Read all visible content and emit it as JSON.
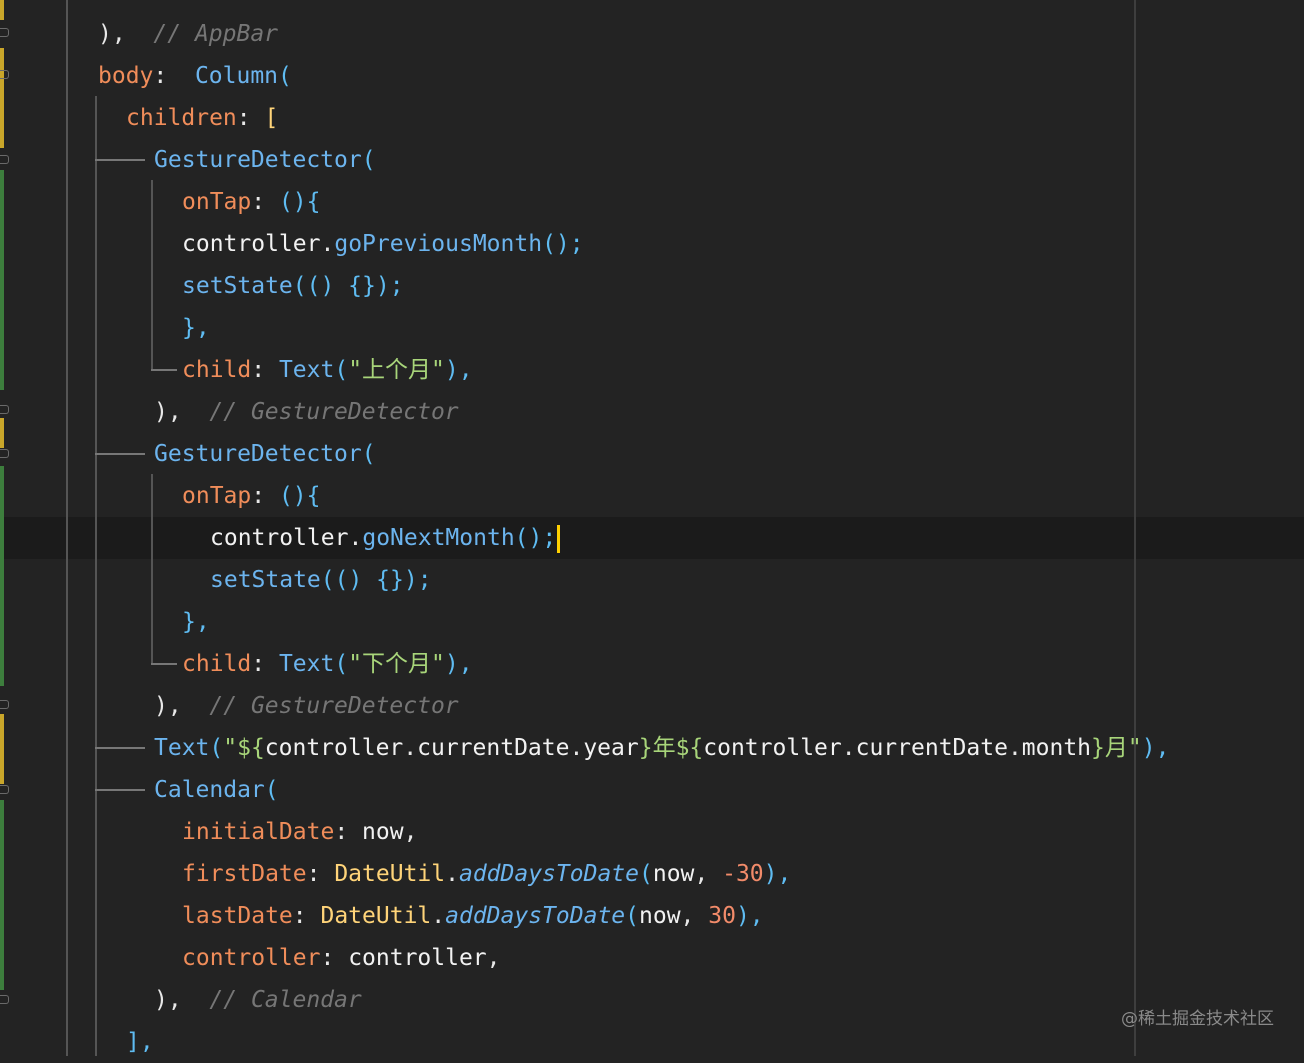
{
  "code_lines": [
    {
      "indent": 4,
      "tokens": [
        {
          "t": "),",
          "c": "p"
        },
        {
          "t": "  // AppBar",
          "c": "cmt"
        }
      ]
    },
    {
      "indent": 4,
      "tokens": [
        {
          "t": "body",
          "c": "k"
        },
        {
          "t": ":  ",
          "c": "p"
        },
        {
          "t": "Column",
          "c": "f"
        },
        {
          "t": "(",
          "c": "br"
        }
      ]
    },
    {
      "indent": 5,
      "tokens": [
        {
          "t": "children",
          "c": "k"
        },
        {
          "t": ": ",
          "c": "p"
        },
        {
          "t": "[",
          "c": "cls"
        }
      ]
    },
    {
      "indent": 6,
      "tokens": [
        {
          "t": "GestureDetector",
          "c": "f"
        },
        {
          "t": "(",
          "c": "br"
        }
      ]
    },
    {
      "indent": 7,
      "tokens": [
        {
          "t": "onTap",
          "c": "k"
        },
        {
          "t": ": ",
          "c": "p"
        },
        {
          "t": "(){",
          "c": "br"
        }
      ]
    },
    {
      "indent": 7,
      "tokens": [
        {
          "t": "controller",
          "c": "v"
        },
        {
          "t": ".",
          "c": "p"
        },
        {
          "t": "goPreviousMonth",
          "c": "f"
        },
        {
          "t": "();",
          "c": "br"
        }
      ]
    },
    {
      "indent": 7,
      "tokens": [
        {
          "t": "setState",
          "c": "f"
        },
        {
          "t": "(() {});",
          "c": "br"
        }
      ]
    },
    {
      "indent": 7,
      "tokens": [
        {
          "t": "},",
          "c": "br"
        }
      ]
    },
    {
      "indent": 7,
      "tokens": [
        {
          "t": "child",
          "c": "k"
        },
        {
          "t": ": ",
          "c": "p"
        },
        {
          "t": "Text",
          "c": "f"
        },
        {
          "t": "(",
          "c": "br"
        },
        {
          "t": "\"上个月\"",
          "c": "str"
        },
        {
          "t": "),",
          "c": "br"
        }
      ]
    },
    {
      "indent": 6,
      "tokens": [
        {
          "t": "),",
          "c": "p"
        },
        {
          "t": "  // GestureDetector",
          "c": "cmt"
        }
      ]
    },
    {
      "indent": 6,
      "tokens": [
        {
          "t": "GestureDetector",
          "c": "f"
        },
        {
          "t": "(",
          "c": "br"
        }
      ]
    },
    {
      "indent": 7,
      "tokens": [
        {
          "t": "onTap",
          "c": "k"
        },
        {
          "t": ": ",
          "c": "p"
        },
        {
          "t": "(){",
          "c": "br"
        }
      ]
    },
    {
      "indent": 8,
      "tokens": [
        {
          "t": "controller",
          "c": "v"
        },
        {
          "t": ".",
          "c": "p"
        },
        {
          "t": "goNextMonth",
          "c": "f"
        },
        {
          "t": "();",
          "c": "br"
        }
      ],
      "caret": true
    },
    {
      "indent": 8,
      "tokens": [
        {
          "t": "setState",
          "c": "f"
        },
        {
          "t": "(() {});",
          "c": "br"
        }
      ]
    },
    {
      "indent": 7,
      "tokens": [
        {
          "t": "},",
          "c": "br"
        }
      ]
    },
    {
      "indent": 7,
      "tokens": [
        {
          "t": "child",
          "c": "k"
        },
        {
          "t": ": ",
          "c": "p"
        },
        {
          "t": "Text",
          "c": "f"
        },
        {
          "t": "(",
          "c": "br"
        },
        {
          "t": "\"下个月\"",
          "c": "str"
        },
        {
          "t": "),",
          "c": "br"
        }
      ]
    },
    {
      "indent": 6,
      "tokens": [
        {
          "t": "),",
          "c": "p"
        },
        {
          "t": "  // GestureDetector",
          "c": "cmt"
        }
      ]
    },
    {
      "indent": 6,
      "tokens": [
        {
          "t": "Text",
          "c": "f"
        },
        {
          "t": "(",
          "c": "br"
        },
        {
          "t": "\"${",
          "c": "str"
        },
        {
          "t": "controller",
          "c": "v"
        },
        {
          "t": ".",
          "c": "p"
        },
        {
          "t": "currentDate",
          "c": "v"
        },
        {
          "t": ".",
          "c": "p"
        },
        {
          "t": "year",
          "c": "v"
        },
        {
          "t": "}年${",
          "c": "str"
        },
        {
          "t": "controller",
          "c": "v"
        },
        {
          "t": ".",
          "c": "p"
        },
        {
          "t": "currentDate",
          "c": "v"
        },
        {
          "t": ".",
          "c": "p"
        },
        {
          "t": "month",
          "c": "v"
        },
        {
          "t": "}月\"",
          "c": "str"
        },
        {
          "t": "),",
          "c": "br"
        }
      ]
    },
    {
      "indent": 6,
      "tokens": [
        {
          "t": "Calendar",
          "c": "f"
        },
        {
          "t": "(",
          "c": "br"
        }
      ]
    },
    {
      "indent": 7,
      "tokens": [
        {
          "t": "initialDate",
          "c": "k"
        },
        {
          "t": ": ",
          "c": "p"
        },
        {
          "t": "now",
          "c": "v"
        },
        {
          "t": ",",
          "c": "p"
        }
      ]
    },
    {
      "indent": 7,
      "tokens": [
        {
          "t": "firstDate",
          "c": "k"
        },
        {
          "t": ": ",
          "c": "p"
        },
        {
          "t": "DateUtil",
          "c": "cls"
        },
        {
          "t": ".",
          "c": "p"
        },
        {
          "t": "addDaysToDate",
          "c": "sm"
        },
        {
          "t": "(",
          "c": "br"
        },
        {
          "t": "now",
          "c": "v"
        },
        {
          "t": ", ",
          "c": "p"
        },
        {
          "t": "-30",
          "c": "num"
        },
        {
          "t": "),",
          "c": "br"
        }
      ]
    },
    {
      "indent": 7,
      "tokens": [
        {
          "t": "lastDate",
          "c": "k"
        },
        {
          "t": ": ",
          "c": "p"
        },
        {
          "t": "DateUtil",
          "c": "cls"
        },
        {
          "t": ".",
          "c": "p"
        },
        {
          "t": "addDaysToDate",
          "c": "sm"
        },
        {
          "t": "(",
          "c": "br"
        },
        {
          "t": "now",
          "c": "v"
        },
        {
          "t": ", ",
          "c": "p"
        },
        {
          "t": "30",
          "c": "num"
        },
        {
          "t": "),",
          "c": "br"
        }
      ]
    },
    {
      "indent": 7,
      "tokens": [
        {
          "t": "controller",
          "c": "k"
        },
        {
          "t": ": ",
          "c": "p"
        },
        {
          "t": "controller",
          "c": "v"
        },
        {
          "t": ",",
          "c": "p"
        }
      ]
    },
    {
      "indent": 6,
      "tokens": [
        {
          "t": "),",
          "c": "p"
        },
        {
          "t": "  // Calendar",
          "c": "cmt"
        }
      ]
    },
    {
      "indent": 5,
      "tokens": [
        {
          "t": "],",
          "c": "br"
        }
      ]
    }
  ],
  "watermark": "@稀土掘金技术社区"
}
